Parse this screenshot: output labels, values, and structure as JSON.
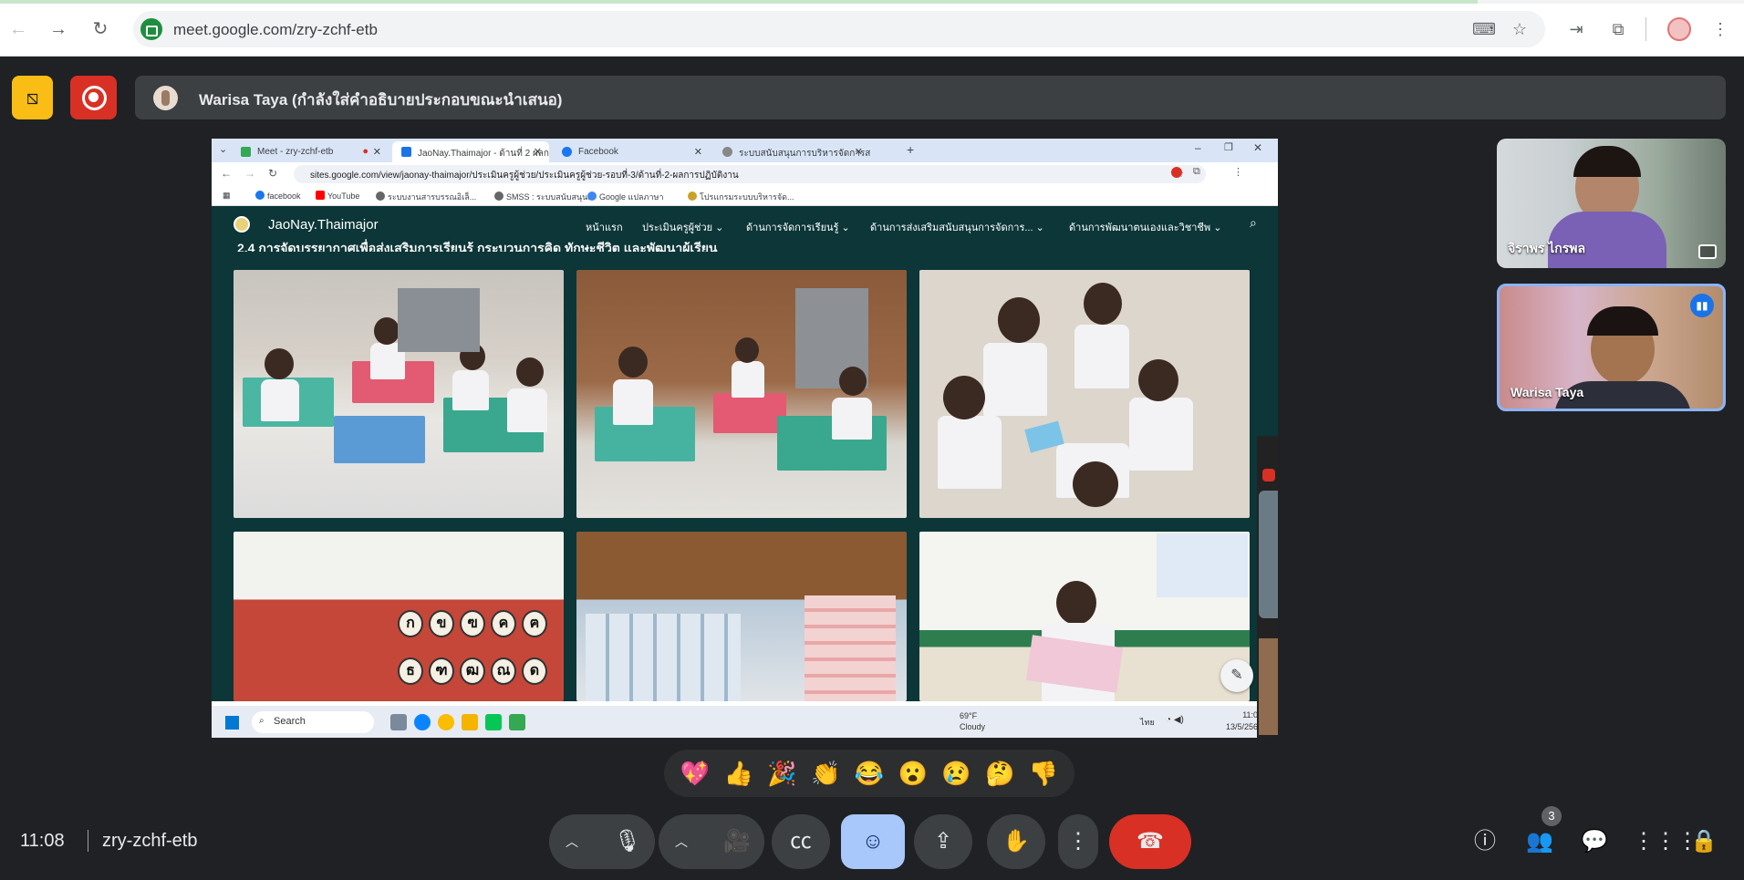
{
  "browser": {
    "url": "meet.google.com/zry-zchf-etb"
  },
  "meet": {
    "presenter_text": "Warisa Taya (กำลังใส่คำอธิบายประกอบขณะนำเสนอ)",
    "time": "11:08",
    "meeting_code": "zry-zchf-etb",
    "people_count": "3",
    "participants": [
      {
        "name": "จิราพร ไกรพล"
      },
      {
        "name": "Warisa Taya"
      }
    ],
    "reactions": [
      "💖",
      "👍",
      "🎉",
      "👏",
      "😂",
      "😮",
      "😢",
      "🤔",
      "👎"
    ],
    "colors": {
      "leave": "#d93025",
      "reaction_active": "#a8c7fa",
      "camera_off": "#f9bd16"
    }
  },
  "shared": {
    "tabs": [
      {
        "label": "Meet - zry-zchf-etb"
      },
      {
        "label": "JaoNay.Thaimajor - ด้านที่ 2 ผลก"
      },
      {
        "label": "Facebook"
      },
      {
        "label": "ระบบสนับสนุนการบริหารจัดการสถา"
      }
    ],
    "url": "sites.google.com/view/jaonay-thaimajor/ประเมินครูผู้ช่วย/ประเมินครูผู้ช่วย-รอบที่-3/ด้านที่-2-ผลการปฏิบัติงาน",
    "bookmarks": [
      {
        "label": "facebook"
      },
      {
        "label": "YouTube"
      },
      {
        "label": "ระบบงานสารบรรณอิเล็..."
      },
      {
        "label": "SMSS : ระบบสนับสนุน..."
      },
      {
        "label": "Google แปลภาษา"
      },
      {
        "label": "โปรแกรมระบบบริหารจัด..."
      }
    ],
    "site_title": "JaoNay.Thaimajor",
    "menu": [
      {
        "label": "หน้าแรก"
      },
      {
        "label": "ประเมินครูผู้ช่วย ⌄"
      },
      {
        "label": "ด้านการจัดการเรียนรู้ ⌄"
      },
      {
        "label": "ด้านการส่งเสริมสนับสนุนการจัดการ... ⌄"
      },
      {
        "label": "ด้านการพัฒนาตนเองและวิชาชีพ ⌄"
      }
    ],
    "section_heading": "2.4 การจัดบรรยากาศเพื่อส่งเสริมการเรียนรู้ กระบวนการคิด ทักษะชีวิต และพัฒนาผู้เรียน",
    "letters_row1": [
      "ก",
      "ข",
      "ฃ",
      "ค",
      "ฅ"
    ],
    "letters_row2": [
      "ธ",
      "ฑ",
      "ฒ",
      "ณ",
      "ด"
    ],
    "taskbar": {
      "search": "Search",
      "weather_temp": "69°F",
      "weather_text": "Cloudy",
      "lang": "ไทย",
      "time": "11:08",
      "date": "13/5/2568"
    }
  }
}
